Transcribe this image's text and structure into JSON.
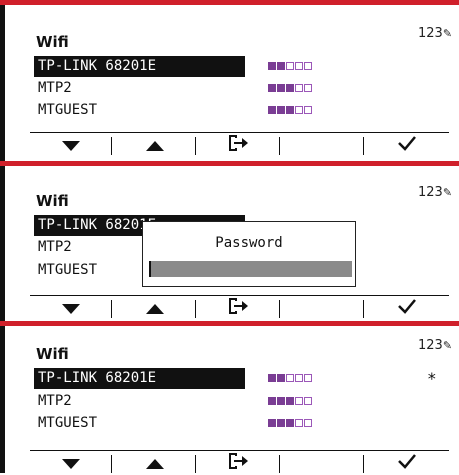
{
  "screen1": {
    "title": "Wifi",
    "mode": "123",
    "networks": [
      {
        "name": "TP-LINK 68201E",
        "signal": 2,
        "of": 5,
        "selected": true
      },
      {
        "name": "MTP2",
        "signal": 3,
        "of": 5,
        "selected": false
      },
      {
        "name": "MTGUEST",
        "signal": 3,
        "of": 5,
        "selected": false
      }
    ]
  },
  "screen2": {
    "title": "Wifi",
    "mode": "123",
    "networks": [
      {
        "name": "TP-LINK 68201E",
        "selected": true
      },
      {
        "name": "MTP2",
        "selected": false
      },
      {
        "name": "MTGUEST",
        "selected": false
      }
    ],
    "dialog": {
      "title": "Password",
      "value": ""
    }
  },
  "screen3": {
    "title": "Wifi",
    "mode": "123",
    "networks": [
      {
        "name": "TP-LINK 68201E",
        "signal": 2,
        "of": 5,
        "selected": true,
        "mark": "*"
      },
      {
        "name": "MTP2",
        "signal": 3,
        "of": 5,
        "selected": false
      },
      {
        "name": "MTGUEST",
        "signal": 3,
        "of": 5,
        "selected": false
      }
    ]
  },
  "softkeys": [
    "down-arrow-icon",
    "up-arrow-icon",
    "enter-icon",
    "",
    "checkmark-icon"
  ],
  "colors": {
    "accent": "#d0202b",
    "signal_on": "#7a3d94",
    "signal_off": "#9b57b8"
  }
}
